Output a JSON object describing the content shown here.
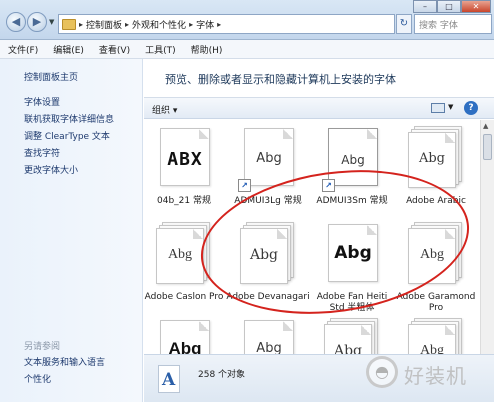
{
  "titlebar": {
    "address": [
      "控制面板",
      "外观和个性化",
      "字体"
    ],
    "search_placeholder": "搜索 字体"
  },
  "menu": [
    "文件(F)",
    "编辑(E)",
    "查看(V)",
    "工具(T)",
    "帮助(H)"
  ],
  "sidebar": {
    "home": "控制面板主页",
    "links": [
      "字体设置",
      "联机获取字体详细信息",
      "调整 ClearType 文本",
      "查找字符",
      "更改字体大小"
    ],
    "see_also_title": "另请参阅",
    "see_also": [
      "文本服务和输入语言",
      "个性化"
    ]
  },
  "header": {
    "title": "预览、删除或者显示和隐藏计算机上安装的字体"
  },
  "toolbar": {
    "organize": "组织 ▾"
  },
  "fonts": [
    {
      "name": "04b_21 常规",
      "sample": "ABX"
    },
    {
      "name": "ADMUI3Lg 常规",
      "sample": "Abg"
    },
    {
      "name": "ADMUI3Sm 常规",
      "sample": "Abg"
    },
    {
      "name": "Adobe Arabic",
      "sample": "Abg"
    },
    {
      "name": "Adobe Caslon Pro",
      "sample": "Abg"
    },
    {
      "name": "Adobe Devanagari",
      "sample": "Abg"
    },
    {
      "name": "Adobe Fan Heiti Std 半粗体",
      "sample": "Abg"
    },
    {
      "name": "Adobe Garamond Pro",
      "sample": "Abg"
    },
    {
      "name": "",
      "sample": "Abg"
    },
    {
      "name": "",
      "sample": "Abg"
    },
    {
      "name": "",
      "sample": "Abg"
    },
    {
      "name": "",
      "sample": "Abg"
    }
  ],
  "status": {
    "count": "258 个对象",
    "icon_letter": "A"
  },
  "watermark": {
    "text": "好装机",
    "icon": "shield-icon"
  },
  "colors": {
    "annotation": "#d4231d",
    "link": "#1e3a6e"
  }
}
